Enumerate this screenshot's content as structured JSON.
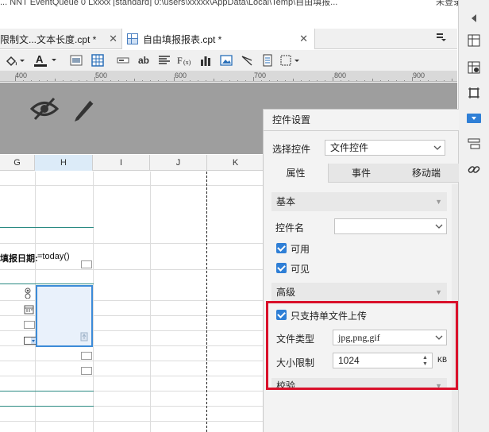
{
  "titlebar": {
    "text": "... NNT EventQueue 0 Lxxxx [standard] 0:\\users\\xxxxx\\AppData\\Local\\Temp\\自由填报...",
    "user": "未登录"
  },
  "tabs": [
    {
      "label": "限制文...文本长度.cpt *",
      "close": "✕"
    },
    {
      "label": "自由填报报表.cpt *",
      "close": "✕"
    }
  ],
  "ruler": {
    "labels": [
      "400",
      "500",
      "600",
      "700",
      "800",
      "900"
    ]
  },
  "columns": [
    "G",
    "H",
    "I",
    "J",
    "K"
  ],
  "grid": {
    "date_label": "填报日期:",
    "formula": "=today()"
  },
  "panel": {
    "title": "控件设置",
    "select_label": "选择控件",
    "select_value": "文件控件",
    "tabs": [
      "属性",
      "事件",
      "移动端"
    ],
    "basic": "基本",
    "name_label": "控件名",
    "name_value": "",
    "enabled": "可用",
    "visible": "可见",
    "advanced": "高级",
    "single_file": "只支持单文件上传",
    "file_type_label": "文件类型",
    "file_type_value": "jpg,png,gif",
    "size_limit_label": "大小限制",
    "size_limit_value": "1024",
    "size_unit": "KB",
    "validate": "校验"
  }
}
